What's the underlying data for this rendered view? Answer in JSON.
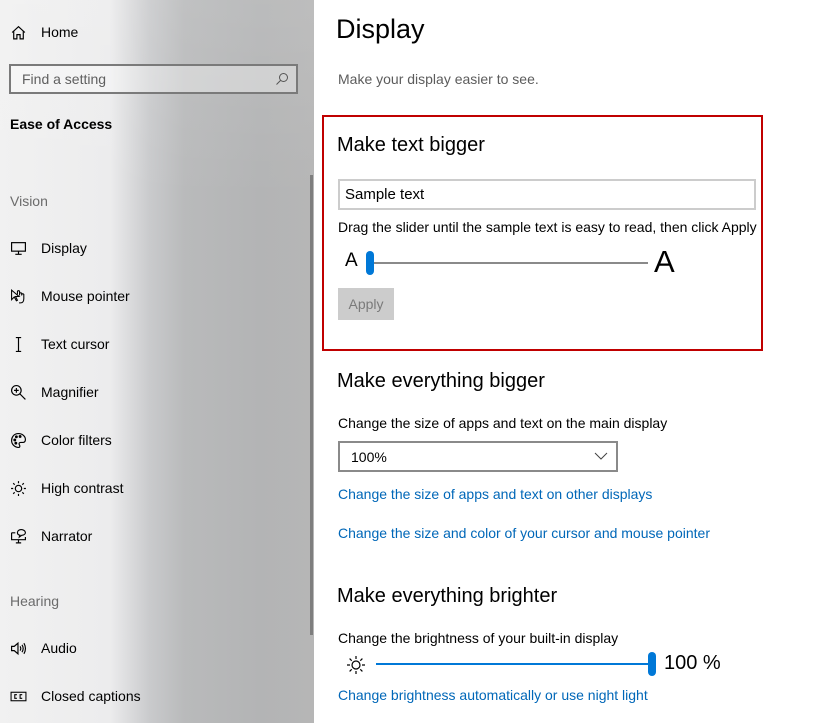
{
  "sidebar": {
    "home_label": "Home",
    "search_placeholder": "Find a setting",
    "category": "Ease of Access",
    "sections": [
      {
        "label": "Vision",
        "items": [
          {
            "label": "Display",
            "icon": "monitor-icon"
          },
          {
            "label": "Mouse pointer",
            "icon": "mouse-pointer-icon"
          },
          {
            "label": "Text cursor",
            "icon": "text-cursor-icon"
          },
          {
            "label": "Magnifier",
            "icon": "magnifier-icon"
          },
          {
            "label": "Color filters",
            "icon": "palette-icon"
          },
          {
            "label": "High contrast",
            "icon": "high-contrast-icon"
          },
          {
            "label": "Narrator",
            "icon": "narrator-icon"
          }
        ]
      },
      {
        "label": "Hearing",
        "items": [
          {
            "label": "Audio",
            "icon": "speaker-icon"
          },
          {
            "label": "Closed captions",
            "icon": "closed-captions-icon"
          }
        ]
      }
    ]
  },
  "main": {
    "title": "Display",
    "subtitle": "Make your display easier to see.",
    "text_bigger": {
      "title": "Make text bigger",
      "sample_text": "Sample text",
      "instructions": "Drag the slider until the sample text is easy to read, then click Apply",
      "small_a": "A",
      "large_a": "A",
      "slider_value_percent": 0,
      "apply_label": "Apply",
      "apply_enabled": false
    },
    "everything_bigger": {
      "title": "Make everything bigger",
      "description": "Change the size of apps and text on the main display",
      "scale_selected": "100%",
      "link_other_displays": "Change the size of apps and text on other displays",
      "link_cursor": "Change the size and color of your cursor and mouse pointer"
    },
    "brighter": {
      "title": "Make everything brighter",
      "description": "Change the brightness of your built-in display",
      "brightness_percent": 100,
      "brightness_label": "100 %",
      "link_night_light": "Change brightness automatically or use night light"
    }
  },
  "colors": {
    "accent": "#0078d7",
    "link": "#0067b8",
    "highlight_border": "#c00000"
  }
}
